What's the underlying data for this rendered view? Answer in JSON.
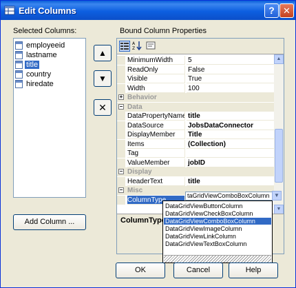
{
  "window": {
    "title": "Edit Columns",
    "help_label": "?",
    "close_label": "✕"
  },
  "selected_columns": {
    "label": "Selected Columns:",
    "items": [
      "employeeid",
      "lastname",
      "title",
      "country",
      "hiredate"
    ],
    "selected_index": 2
  },
  "side_buttons": {
    "up": "▲",
    "down": "▼",
    "remove": "✕"
  },
  "add_column_button": "Add Column ...",
  "properties": {
    "label": "Bound Column Properties",
    "toolbar": {
      "categorized_icon": "categorized-icon",
      "alphabetical_icon": "alphabetical-icon",
      "property-pages_icon": "property-pages-icon"
    },
    "rows": [
      {
        "type": "prop",
        "name": "MinimumWidth",
        "value": "5"
      },
      {
        "type": "prop",
        "name": "ReadOnly",
        "value": "False"
      },
      {
        "type": "prop",
        "name": "Visible",
        "value": "True"
      },
      {
        "type": "prop",
        "name": "Width",
        "value": "100"
      },
      {
        "type": "cat",
        "name": "Behavior",
        "expander": "+"
      },
      {
        "type": "cat",
        "name": "Data",
        "expander": "−"
      },
      {
        "type": "prop",
        "name": "DataPropertyName",
        "value": "title",
        "bold": true
      },
      {
        "type": "prop",
        "name": "DataSource",
        "value": "JobsDataConnector",
        "bold": true
      },
      {
        "type": "prop",
        "name": "DisplayMember",
        "value": "Title",
        "bold": true
      },
      {
        "type": "prop",
        "name": "Items",
        "value": "(Collection)",
        "bold": true
      },
      {
        "type": "prop",
        "name": "Tag",
        "value": ""
      },
      {
        "type": "prop",
        "name": "ValueMember",
        "value": "jobID",
        "bold": true
      },
      {
        "type": "cat",
        "name": "Display",
        "expander": "−"
      },
      {
        "type": "prop",
        "name": "HeaderText",
        "value": "title",
        "bold": true
      },
      {
        "type": "cat",
        "name": "Misc",
        "expander": "−"
      },
      {
        "type": "prop",
        "name": "ColumnType",
        "value": "",
        "selected": true
      }
    ],
    "combo_value": "taGridViewComboBoxColumn",
    "description_title": "ColumnType"
  },
  "dropdown": {
    "options": [
      "DataGridViewButtonColumn",
      "DataGridViewCheckBoxColumn",
      "DataGridViewComboBoxColumn",
      "DataGridViewImageColumn",
      "DataGridViewLinkColumn",
      "DataGridViewTextBoxColumn"
    ],
    "selected_index": 2
  },
  "footer": {
    "ok": "OK",
    "cancel": "Cancel",
    "help": "Help"
  },
  "colors": {
    "title_bar": "#0a5fd8",
    "selection": "#316ac5",
    "dialog_bg": "#ece9d8"
  }
}
